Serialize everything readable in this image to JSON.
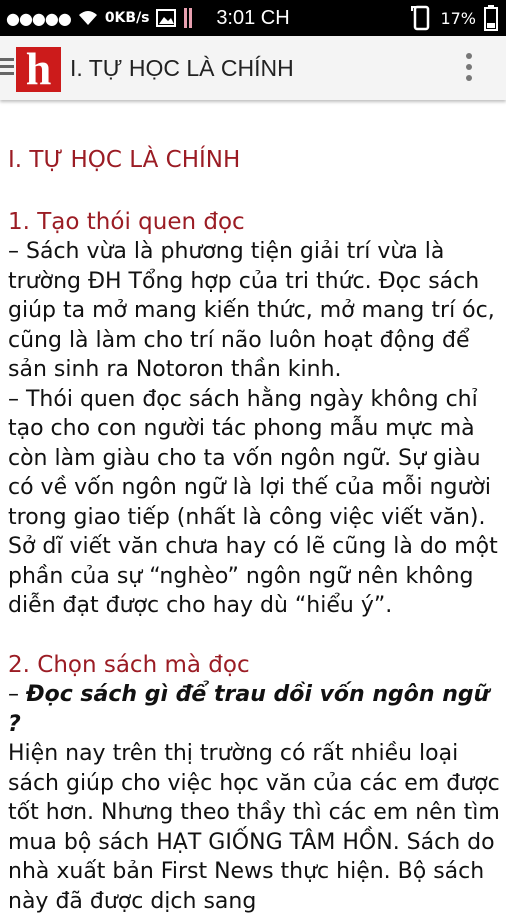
{
  "status_bar": {
    "signal_dots": "●●●●●",
    "network_speed": "0KB/s",
    "time": "3:01 CH",
    "battery_percent": "17%"
  },
  "toolbar": {
    "logo_letter": "h",
    "title": "I. TỰ HỌC LÀ CHÍNH"
  },
  "article": {
    "heading": "I. TỰ HỌC LÀ CHÍNH",
    "section1_title": "1. Tạo thói quen đọc",
    "section1_p1": "– Sách vừa là phương tiện giải trí vừa là trường ĐH Tổng hợp của tri thức. Đọc sách giúp ta mở mang kiến thức, mở mang trí óc, cũng là làm cho trí não luôn hoạt động để sản sinh ra Notoron thần kinh.",
    "section1_p2": "– Thói quen đọc sách hằng ngày không chỉ tạo cho con người tác phong mẫu mực mà còn làm giàu cho ta vốn ngôn ngữ. Sự giàu có về vốn ngôn ngữ là lợi thế của mỗi người trong giao tiếp (nhất là công việc viết văn). Sở dĩ viết văn chưa hay có lẽ cũng là do một phần của sự “nghèo” ngôn ngữ nên không diễn đạt được cho hay dù “hiểu ý”.",
    "section2_title": "2. Chọn sách mà đọc",
    "section2_dash": "– ",
    "section2_question": "Đọc sách gì để trau dồi vốn ngôn ngữ ?",
    "section2_p1": "Hiện nay trên thị trường có rất nhiều loại sách giúp cho việc học văn của các em được tốt hơn. Nhưng theo thầy thì các em nên tìm mua bộ sách HẠT GIỐNG TÂM HỒN. Sách do nhà xuất bản First News thực hiện. Bộ sách này đã được dịch sang"
  }
}
